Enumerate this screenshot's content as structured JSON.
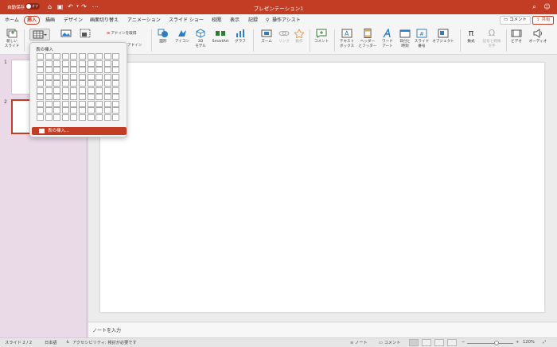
{
  "app": {
    "title": "プレゼンテーション1",
    "autosave_label": "自動保存",
    "autosave_state": "オフ",
    "accent_color": "#c23d24"
  },
  "tabs": [
    {
      "label": "ホーム",
      "active": false
    },
    {
      "label": "挿入",
      "active": true
    },
    {
      "label": "描画",
      "active": false
    },
    {
      "label": "デザイン",
      "active": false
    },
    {
      "label": "画面切り替え",
      "active": false
    },
    {
      "label": "アニメーション",
      "active": false
    },
    {
      "label": "スライド ショー",
      "active": false
    },
    {
      "label": "校閲",
      "active": false
    },
    {
      "label": "表示",
      "active": false
    },
    {
      "label": "記録",
      "active": false
    },
    {
      "label": "操作アシスト",
      "active": false
    }
  ],
  "header_buttons": {
    "comments": "コメント",
    "share": "共有"
  },
  "ribbon": {
    "new_slide": "新しい\nスライド",
    "addin": "アドインを取得",
    "my_addin": "アドイン",
    "shapes": "図形",
    "icons": "アイコン",
    "model3d": "3D\nモデル",
    "smartart": "SmartArt",
    "chart": "グラフ",
    "zoom": "ズーム",
    "link": "リンク",
    "action": "動作",
    "comment": "コメント",
    "textbox": "テキスト\nボックス",
    "header_footer": "ヘッダー\nとフッター",
    "wordart": "ワード\nアート",
    "datetime": "日付と\n時刻",
    "slide_number": "スライド\n番号",
    "object": "オブジェクト",
    "equation": "数式",
    "symbol": "記号と特殊\n文字",
    "video": "ビデオ",
    "audio": "オーディオ"
  },
  "table_dropdown": {
    "title": "表の挿入",
    "rows": 10,
    "cols": 10,
    "menu_item": "表の挿入..."
  },
  "thumbnails": [
    {
      "number": "1",
      "selected": false
    },
    {
      "number": "2",
      "selected": true
    }
  ],
  "notes_placeholder": "ノートを入力",
  "status": {
    "slide_info": "スライド 2 / 2",
    "language": "日本語",
    "accessibility": "アクセシビリティ: 検討が必要です",
    "notes": "ノート",
    "comments": "コメント",
    "zoom": "120%"
  }
}
